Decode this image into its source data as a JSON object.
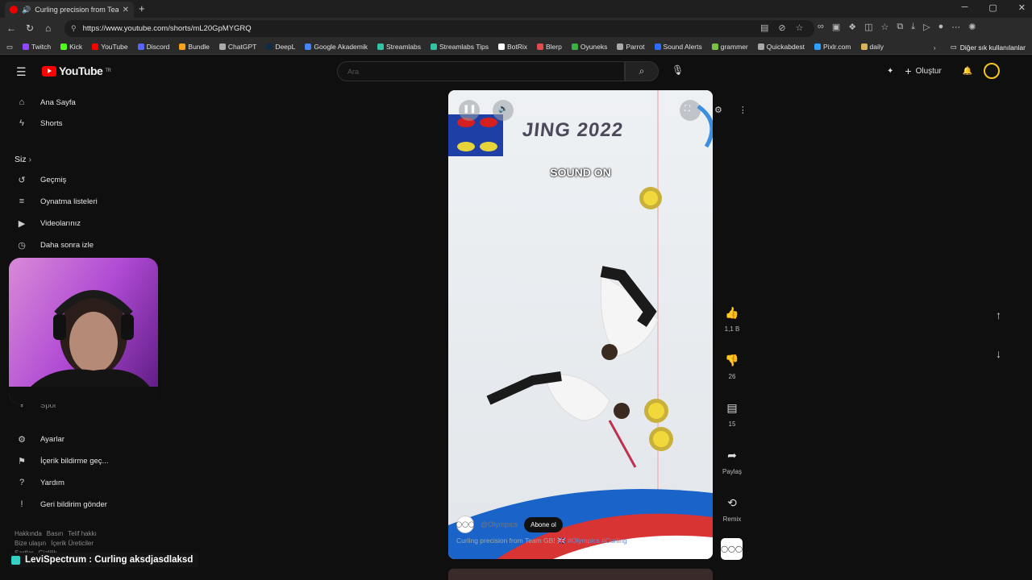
{
  "browser": {
    "tab_title": "Curling precision from Team",
    "url": "https://www.youtube.com/shorts/mL20GpMYGRQ",
    "bookmarks": [
      {
        "label": "Twitch",
        "color": "#9146ff"
      },
      {
        "label": "Kick",
        "color": "#53fc18"
      },
      {
        "label": "YouTube",
        "color": "#ff0000"
      },
      {
        "label": "Discord",
        "color": "#5865f2"
      },
      {
        "label": "Bundle",
        "color": "#f7a21b"
      },
      {
        "label": "ChatGPT",
        "color": "#aaaaaa"
      },
      {
        "label": "DeepL",
        "color": "#0f2b46"
      },
      {
        "label": "Google Akademik",
        "color": "#4285f4"
      },
      {
        "label": "Streamlabs",
        "color": "#31c3a2"
      },
      {
        "label": "Streamlabs Tips",
        "color": "#31c3a2"
      },
      {
        "label": "BotRix",
        "color": "#ffffff"
      },
      {
        "label": "Blerp",
        "color": "#e24b4b"
      },
      {
        "label": "Oyuneks",
        "color": "#3cb043"
      },
      {
        "label": "Parrot",
        "color": "#aaaaaa"
      },
      {
        "label": "Sound Alerts",
        "color": "#2f6bff"
      },
      {
        "label": "grammer",
        "color": "#7ac142"
      },
      {
        "label": "Quickabdest",
        "color": "#aaaaaa"
      },
      {
        "label": "Pixlr.com",
        "color": "#2da0ff"
      },
      {
        "label": "daily",
        "color": "#d8b35c"
      }
    ],
    "other_bookmarks": "Diğer sık kullanılanlar"
  },
  "youtube": {
    "logo": "YouTube",
    "logo_region": "TR",
    "search_placeholder": "Ara",
    "create_label": "Oluştur",
    "sidebar": {
      "top": [
        {
          "label": "Ana Sayfa",
          "icon": "home-icon"
        },
        {
          "label": "Shorts",
          "icon": "shorts-icon"
        }
      ],
      "section": "Siz",
      "you": [
        {
          "label": "Geçmiş",
          "icon": "history-icon"
        },
        {
          "label": "Oynatma listeleri",
          "icon": "playlist-icon"
        },
        {
          "label": "Videolarınız",
          "icon": "video-icon"
        },
        {
          "label": "Daha sonra izle",
          "icon": "clock-icon"
        }
      ],
      "partial_item": "Spor",
      "bottom": [
        {
          "label": "Ayarlar",
          "icon": "gear-icon"
        },
        {
          "label": "İçerik bildirme geç...",
          "icon": "flag-icon"
        },
        {
          "label": "Yardım",
          "icon": "help-icon"
        },
        {
          "label": "Geri bildirim gönder",
          "icon": "feedback-icon"
        }
      ],
      "footer_row1": [
        "Hakkında",
        "Basın",
        "Telif hakkı"
      ],
      "footer_row2": [
        "Bize ulaşın",
        "İçerik Üreticiler"
      ],
      "footer_row3": [
        "Şartlar",
        "Gizlilik"
      ]
    },
    "short": {
      "overlay_text": "SOUND ON",
      "rink_text": "JING 2022",
      "channel": "@Olympics",
      "subscribe": "Abone ol",
      "title": "Curling precision from Team GB!",
      "hashtags": "#Olympics #Curling"
    },
    "actions": {
      "likes": "1,1 B",
      "dislikes": "26",
      "comments": "15",
      "share": "Paylaş",
      "remix": "Remix"
    }
  },
  "stream_chat": {
    "message": "LeviSpectrum : Curling aksdjasdlaksd"
  }
}
